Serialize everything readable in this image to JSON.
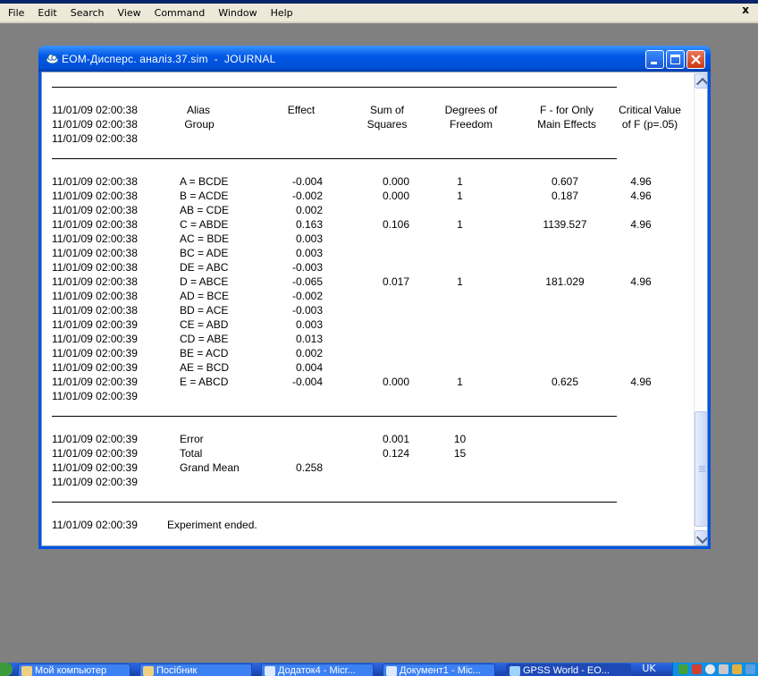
{
  "menu": [
    "File",
    "Edit",
    "Search",
    "View",
    "Command",
    "Window",
    "Help"
  ],
  "mdi_close": "x",
  "window": {
    "title": "EOM-Дисперс. аналіз.37.sim  -  JOURNAL",
    "icon": "gpss-cloud-icon"
  },
  "journal": {
    "header_timestamps": [
      "11/01/09 02:00:38",
      "11/01/09 02:00:38",
      "11/01/09 02:00:38"
    ],
    "headers": {
      "alias": [
        "Alias",
        "Group"
      ],
      "effect": "Effect",
      "sum_of_squares": [
        "Sum of",
        "Squares"
      ],
      "dof": [
        "Degrees of",
        "Freedom"
      ],
      "f_value": [
        "F - for Only",
        "Main Effects"
      ],
      "critical": [
        "Critical Value",
        "of F (p=.05)"
      ]
    },
    "rows": [
      {
        "ts": "11/01/09 02:00:38",
        "alias": "A =  BCDE",
        "effect": "-0.004",
        "ss": "0.000",
        "dof": "1",
        "f": "0.607",
        "crit": "4.96"
      },
      {
        "ts": "11/01/09 02:00:38",
        "alias": "B =  ACDE",
        "effect": "-0.002",
        "ss": "0.000",
        "dof": "1",
        "f": "0.187",
        "crit": "4.96"
      },
      {
        "ts": "11/01/09 02:00:38",
        "alias": "AB =  CDE",
        "effect": "0.002",
        "ss": "",
        "dof": "",
        "f": "",
        "crit": ""
      },
      {
        "ts": "11/01/09 02:00:38",
        "alias": "C =  ABDE",
        "effect": "0.163",
        "ss": "0.106",
        "dof": "1",
        "f": "1139.527",
        "crit": "4.96"
      },
      {
        "ts": "11/01/09 02:00:38",
        "alias": "AC =  BDE",
        "effect": "0.003",
        "ss": "",
        "dof": "",
        "f": "",
        "crit": ""
      },
      {
        "ts": "11/01/09 02:00:38",
        "alias": "BC =  ADE",
        "effect": "0.003",
        "ss": "",
        "dof": "",
        "f": "",
        "crit": ""
      },
      {
        "ts": "11/01/09 02:00:38",
        "alias": "DE =  ABC",
        "effect": "-0.003",
        "ss": "",
        "dof": "",
        "f": "",
        "crit": ""
      },
      {
        "ts": "11/01/09 02:00:38",
        "alias": "D =  ABCE",
        "effect": "-0.065",
        "ss": "0.017",
        "dof": "1",
        "f": "181.029",
        "crit": "4.96"
      },
      {
        "ts": "11/01/09 02:00:38",
        "alias": "AD =  BCE",
        "effect": "-0.002",
        "ss": "",
        "dof": "",
        "f": "",
        "crit": ""
      },
      {
        "ts": "11/01/09 02:00:38",
        "alias": "BD =  ACE",
        "effect": "-0.003",
        "ss": "",
        "dof": "",
        "f": "",
        "crit": ""
      },
      {
        "ts": "11/01/09 02:00:39",
        "alias": "CE =  ABD",
        "effect": "0.003",
        "ss": "",
        "dof": "",
        "f": "",
        "crit": ""
      },
      {
        "ts": "11/01/09 02:00:39",
        "alias": "CD =  ABE",
        "effect": "0.013",
        "ss": "",
        "dof": "",
        "f": "",
        "crit": ""
      },
      {
        "ts": "11/01/09 02:00:39",
        "alias": "BE =  ACD",
        "effect": "0.002",
        "ss": "",
        "dof": "",
        "f": "",
        "crit": ""
      },
      {
        "ts": "11/01/09 02:00:39",
        "alias": "AE =  BCD",
        "effect": "0.004",
        "ss": "",
        "dof": "",
        "f": "",
        "crit": ""
      },
      {
        "ts": "11/01/09 02:00:39",
        "alias": "E =  ABCD",
        "effect": "-0.004",
        "ss": "0.000",
        "dof": "1",
        "f": "0.625",
        "crit": "4.96"
      },
      {
        "ts": "11/01/09 02:00:39",
        "alias": "",
        "effect": "",
        "ss": "",
        "dof": "",
        "f": "",
        "crit": ""
      }
    ],
    "summary": [
      {
        "ts": "11/01/09 02:00:39",
        "alias": "Error",
        "effect": "",
        "ss": "0.001",
        "dof": "10"
      },
      {
        "ts": "11/01/09 02:00:39",
        "alias": "Total",
        "effect": "",
        "ss": "0.124",
        "dof": "15"
      },
      {
        "ts": "11/01/09 02:00:39",
        "alias": "Grand Mean",
        "effect": "0.258",
        "ss": "",
        "dof": ""
      },
      {
        "ts": "11/01/09 02:00:39",
        "alias": "",
        "effect": "",
        "ss": "",
        "dof": ""
      }
    ],
    "end_ts": "11/01/09 02:00:39",
    "end_text": "Experiment ended."
  },
  "taskbar": {
    "tasks": [
      "Мой компьютер",
      "Посібник",
      "Додаток4 - Micr...",
      "Документ1 - Mic...",
      "GPSS World - EO..."
    ],
    "lang": "UK"
  }
}
